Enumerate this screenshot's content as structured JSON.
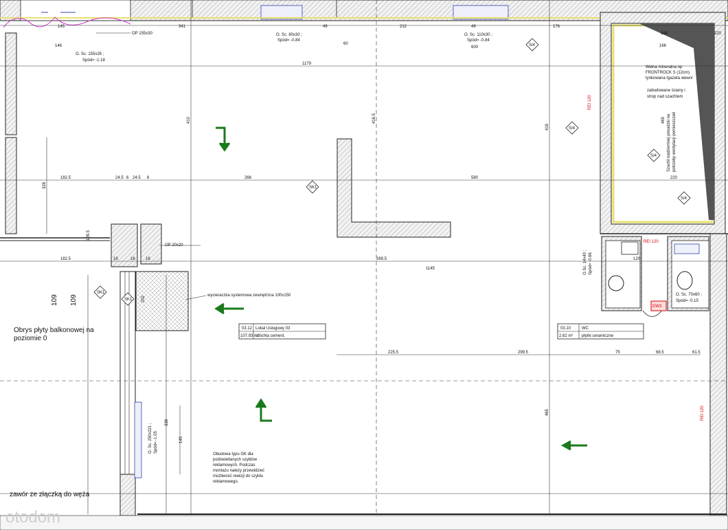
{
  "openings": {
    "op_top": "OP 155x30",
    "op_mid": "OP 20x20",
    "o1_a": "O. Sc. 155x26 ;",
    "o1_b": "Spód= -1.18",
    "o2_a": "O. Sc. 80x30 ;",
    "o2_b": "Spód= -0.84",
    "o3_a": "O. Sc. 110x30 ;",
    "o3_b": "Spód= -0.84",
    "o4_a": "O. Sc. 70x60 ;",
    "o4_b": "Spód= -0.15",
    "o5_a": "O.Sc. 14x40 ;",
    "o5_b": "Spód= -0.66",
    "o6_a": "O. Sc. 250x221 ;",
    "o6_b": "Spód= -1.05"
  },
  "dimensions": {
    "top": [
      "145",
      "341",
      "49",
      "212",
      "49",
      "176",
      "166",
      "220"
    ],
    "upper": [
      "146",
      "60",
      "600",
      "1179",
      "166"
    ],
    "mid": [
      "182.5",
      "24.5",
      "6",
      "24.5",
      "6",
      "266",
      "580",
      "220"
    ],
    "lower": [
      "182.5",
      "16",
      "16",
      "16",
      "269.5",
      "1145",
      "120"
    ],
    "bottom": [
      "225.5",
      "299.5",
      "75",
      "68.5",
      "61.5"
    ],
    "vertical": [
      "410",
      "416.5",
      "416",
      "328",
      "109",
      "109",
      "126.5",
      "338",
      "145",
      "465",
      "465",
      "202"
    ]
  },
  "tags": [
    "SK1",
    "SK1",
    "SK1",
    "S/4",
    "S/4",
    "S/4",
    "S/4",
    "DW3"
  ],
  "rooms": [
    {
      "number": "03.12",
      "name": "Lokal Usługowy 03",
      "area": "107.93 m²",
      "finish": "szlichta cement."
    },
    {
      "number": "03.10",
      "name": "WC",
      "area": "2.62 m²",
      "finish": "płytki ceramiczne"
    }
  ],
  "annotations": {
    "wycieraczka": "wycieraczka systemowa zewnętrzna 100x150",
    "wool_1": "Wełna mineralna np",
    "wool_2": "FRONTROCK S (12cm)",
    "wool_3": "tynkowana /gazeta wewn/",
    "ceiling_1": "zabudowane ściany i",
    "ceiling_2": "strop nad szachtem",
    "shaft_1": "Szacht nadziemnej posadzki na",
    "shaft_2": "potrzeby wentylacji pomieszczeń",
    "balcony_1": "Obrys płyty balkonowej na",
    "balcony_2": "poziomie 0",
    "valve": "zawór ze złączką do węża",
    "gk_1": "Obudowa typu GK dla",
    "gk_2": "podświetlanych szyldów",
    "gk_3": "reklamowych. Podczas",
    "gk_4": "montażu należy przewidzieć",
    "gk_5": "możliwość rewizji do szyldu",
    "gk_6": "reklamowego."
  },
  "fire": [
    "REI 120",
    "REI 120",
    "REI 120"
  ],
  "watermark": "otodom",
  "colors": {
    "line": "#222222",
    "arrow": "#1a7a1a",
    "red": "#d40000",
    "insulation": "#e8e070",
    "hatch": "#888888",
    "watermark": "#cfcfcf"
  }
}
